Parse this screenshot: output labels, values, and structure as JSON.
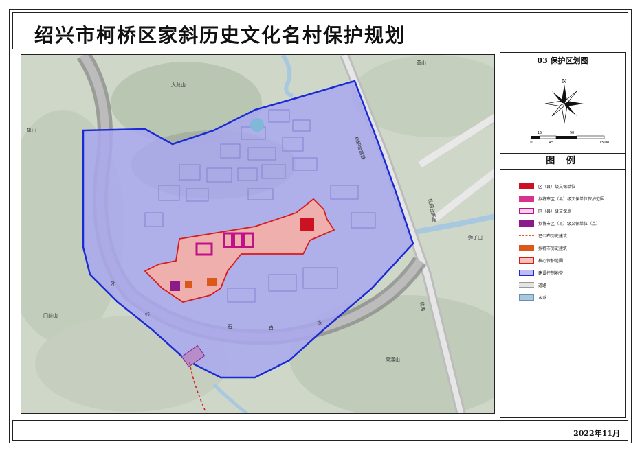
{
  "title": "绍兴市柯桥区家斜历史文化名村保护规划",
  "map_title": "03 保护区划图",
  "compass_letter": "N",
  "scale": {
    "labels": [
      "0",
      "15",
      "45",
      "90",
      "150M"
    ]
  },
  "legend": {
    "heading": "图 例",
    "items": [
      {
        "label": "区（县）级文保单位",
        "color": "#cc1122",
        "style": "solid"
      },
      {
        "label": "拟将市区（县）级文保单位保护范围",
        "color": "#d6338f",
        "style": "solid"
      },
      {
        "label": "区（县）级文保点",
        "color": "#f0b8d8",
        "style": "outline-pink"
      },
      {
        "label": "拟将市区（县）级文保单位（点）",
        "color": "#8b1a8b",
        "style": "solid"
      },
      {
        "label": "已公布历史建筑",
        "color": "#e05a2a",
        "style": "dashed"
      },
      {
        "label": "拟将市历史建筑",
        "color": "#d9581a",
        "style": "solid"
      },
      {
        "label": "核心保护范围",
        "color": "#f7a7a0",
        "style": "outline-red"
      },
      {
        "label": "建设控制地带",
        "color": "#9f9ef0",
        "style": "outline-blue"
      },
      {
        "label": "道路",
        "color": "#c8c8c8",
        "style": "road"
      },
      {
        "label": "水系",
        "color": "#a8c8e0",
        "style": "water"
      }
    ]
  },
  "map_labels": {
    "mountain_1": "大龙山",
    "mountain_2": "象山",
    "mountain_3": "门前山",
    "mountain_4": "狮子山",
    "mountain_5": "高漾山",
    "mountain_6": "草山",
    "railway": "杭绍台高铁",
    "road_1": "杭绍台高速",
    "road_2": "杭甬",
    "road_3": "外",
    "road_4": "线",
    "road_5": "石",
    "road_6": "白",
    "road_7": "铁"
  },
  "date": "2022年11月",
  "colors": {
    "control_zone_fill": "#a9a8ef",
    "control_zone_stroke": "#1a2bd6",
    "core_zone_fill": "#f6b0a6",
    "core_zone_stroke": "#d81b1b",
    "terrain_base": "#cfd7c6"
  }
}
